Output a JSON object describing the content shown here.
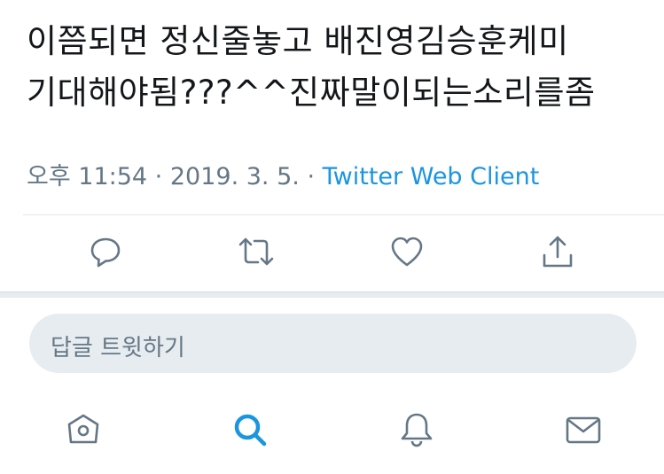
{
  "tweet": {
    "text_lines": [
      "이쯤되면 정신줄놓고 배진영김승훈케미",
      "기대해야됨???^^진짜말이되는소리를좀"
    ],
    "time": "오후 11:54",
    "date": "2019. 3. 5.",
    "separator": "·",
    "client": "Twitter Web Client"
  },
  "actions": [
    {
      "name": "reply",
      "icon": "speech-bubble-icon"
    },
    {
      "name": "retweet",
      "icon": "retweet-icon"
    },
    {
      "name": "like",
      "icon": "heart-icon"
    },
    {
      "name": "share",
      "icon": "share-icon"
    }
  ],
  "reply_box": {
    "placeholder": "답글 트윗하기"
  },
  "tabbar": [
    {
      "name": "home",
      "icon": "home-icon",
      "active": false
    },
    {
      "name": "search",
      "icon": "search-icon",
      "active": true
    },
    {
      "name": "notifications",
      "icon": "bell-icon",
      "active": false
    },
    {
      "name": "messages",
      "icon": "mail-icon",
      "active": false
    }
  ],
  "colors": {
    "text": "#14171a",
    "muted": "#657786",
    "accent": "#1b95e0",
    "icon": "#657786",
    "field_bg": "#e6ecf0"
  }
}
